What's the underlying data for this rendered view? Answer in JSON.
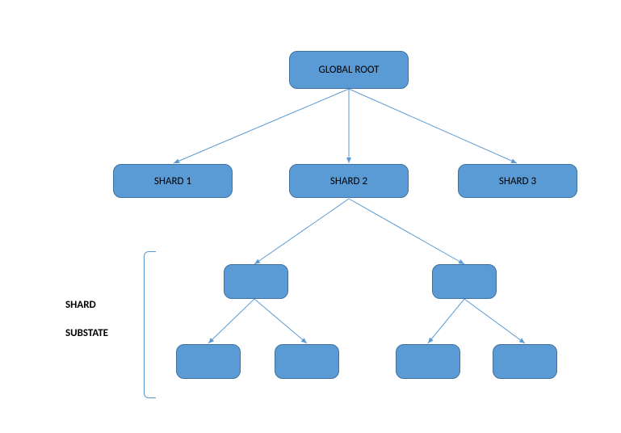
{
  "diagram": {
    "root": {
      "label": "GLOBAL ROOT"
    },
    "shards": [
      {
        "label": "SHARD 1"
      },
      {
        "label": "SHARD 2"
      },
      {
        "label": "SHARD 3"
      }
    ],
    "subnodes": {
      "mid_left": "",
      "mid_right": "",
      "leaf_1": "",
      "leaf_2": "",
      "leaf_3": "",
      "leaf_4": ""
    },
    "annotation": {
      "line1": "SHARD",
      "line2": "SUBSTATE"
    },
    "colors": {
      "node_fill": "#5b9bd5",
      "node_border": "#41719c",
      "connector": "#5b9bd5"
    }
  }
}
